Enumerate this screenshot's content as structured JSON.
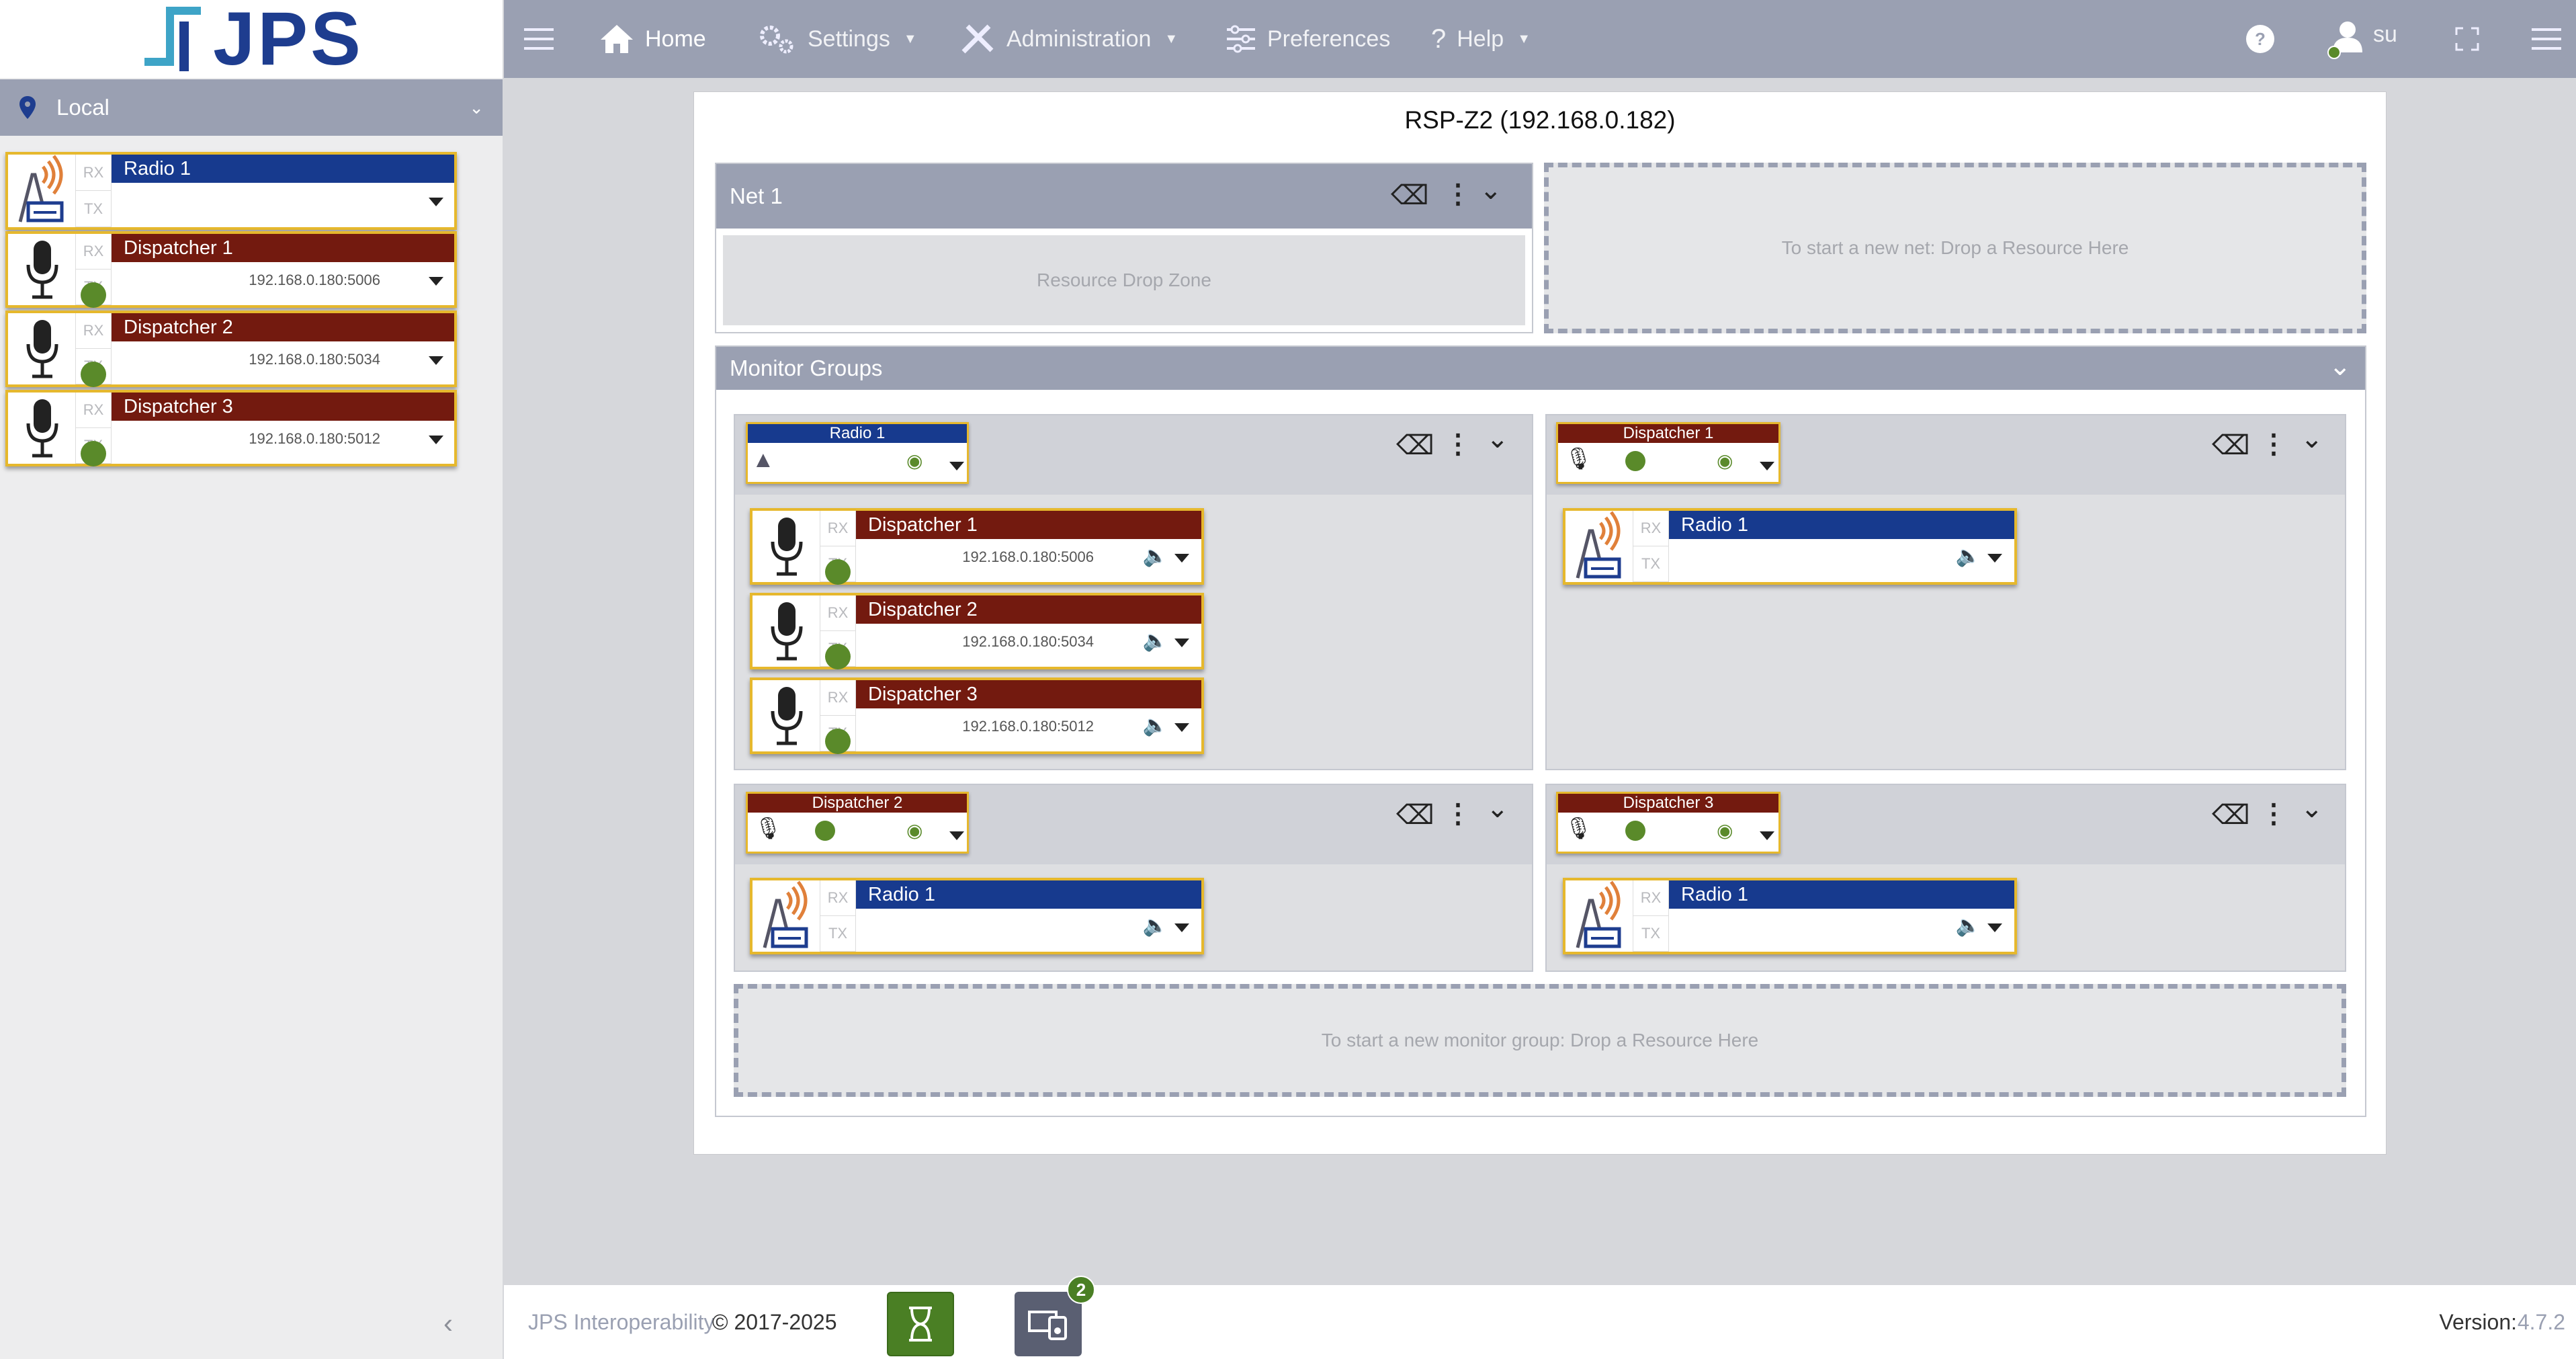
{
  "brand": {
    "logo_text": "JPS"
  },
  "sidebar": {
    "location": "Local",
    "resources": [
      {
        "name": "Radio 1",
        "kind": "radio",
        "address": "",
        "rx": "RX",
        "tx": "TX"
      },
      {
        "name": "Dispatcher 1",
        "kind": "dispatcher",
        "address": "192.168.0.180:5006",
        "rx": "RX",
        "tx": "TX"
      },
      {
        "name": "Dispatcher 2",
        "kind": "dispatcher",
        "address": "192.168.0.180:5034",
        "rx": "RX",
        "tx": "TX"
      },
      {
        "name": "Dispatcher 3",
        "kind": "dispatcher",
        "address": "192.168.0.180:5012",
        "rx": "RX",
        "tx": "TX"
      }
    ]
  },
  "topbar": {
    "home": "Home",
    "settings": "Settings",
    "administration": "Administration",
    "preferences": "Preferences",
    "help": "Help",
    "user": "su"
  },
  "main": {
    "title": "RSP-Z2 (192.168.0.182)",
    "net": {
      "name": "Net 1",
      "drop_zone": "Resource Drop Zone"
    },
    "new_net_hint": "To start a new net: Drop a Resource Here",
    "monitor_groups": {
      "title": "Monitor Groups",
      "new_group_hint": "To start a new monitor group: Drop a Resource Here",
      "groups": [
        {
          "owner": "Radio 1",
          "members": [
            {
              "name": "Dispatcher 1",
              "address": "192.168.0.180:5006"
            },
            {
              "name": "Dispatcher 2",
              "address": "192.168.0.180:5034"
            },
            {
              "name": "Dispatcher 3",
              "address": "192.168.0.180:5012"
            }
          ]
        },
        {
          "owner": "Dispatcher 1",
          "members": [
            {
              "name": "Radio 1",
              "address": ""
            }
          ]
        },
        {
          "owner": "Dispatcher 2",
          "members": [
            {
              "name": "Radio 1",
              "address": ""
            }
          ]
        },
        {
          "owner": "Dispatcher 3",
          "members": [
            {
              "name": "Radio 1",
              "address": ""
            }
          ]
        }
      ]
    }
  },
  "footer": {
    "copyright_brand": "JPS Interoperability",
    "copyright_years": "© 2017-2025",
    "badge_count": "2",
    "version_label": "Version:",
    "version_value": "4.7.2"
  },
  "colors": {
    "radio": "#173a8e",
    "dispatcher": "#731a0f",
    "header": "#9aa0b2",
    "status": "#5a8a2a",
    "border": "#e6b82d"
  }
}
